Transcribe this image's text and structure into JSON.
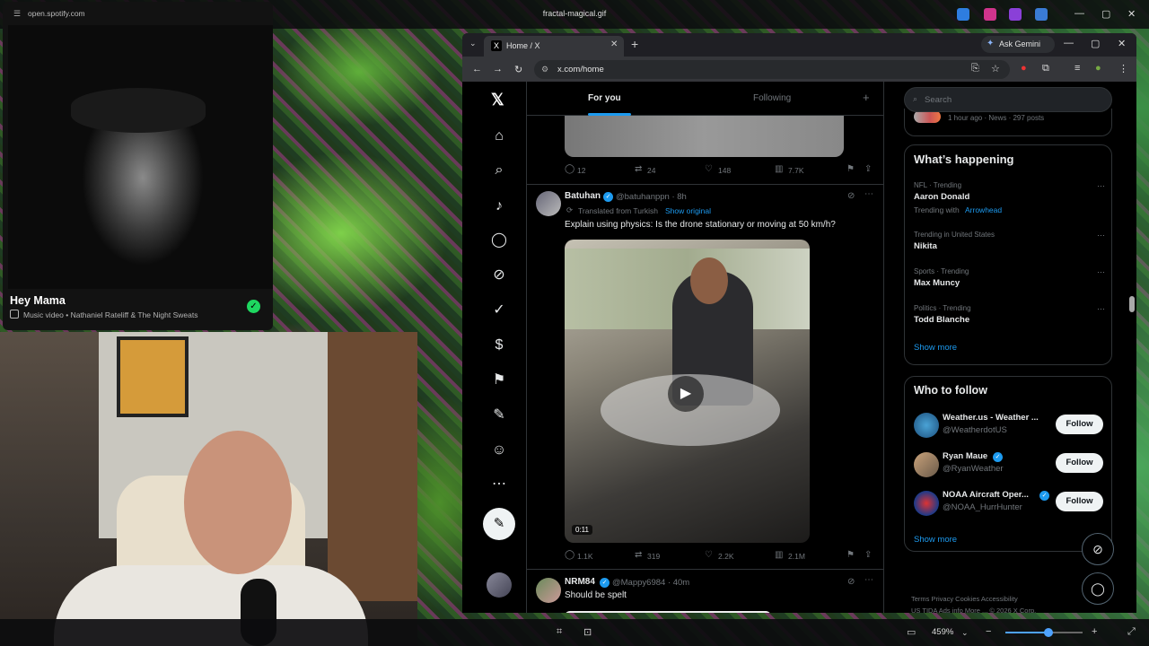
{
  "viewer": {
    "title": "fractal-magical.gif",
    "zoom": "459%",
    "zoom_level": 0.56
  },
  "spotify": {
    "url": "open.spotify.com",
    "title": "Hey Mama",
    "subtitle": "Music video • Nathaniel Rateliff & The Night Sweats"
  },
  "browser": {
    "tab_title": "Home / X",
    "url": "x.com/home",
    "gemini": "Ask Gemini"
  },
  "x": {
    "tabs": {
      "for_you": "For you",
      "following": "Following"
    },
    "prev_tweet": {
      "replies": "12",
      "reposts": "24",
      "likes": "148",
      "views": "7.7K"
    },
    "tweet": {
      "name": "Batuhan",
      "handle": "@batuhanppn · 8h",
      "translated": "Translated from Turkish",
      "show_original": "Show original",
      "text": "Explain using physics: Is the drone stationary or moving at 50 km/h?",
      "duration": "0:11",
      "replies": "1.1K",
      "reposts": "319",
      "likes": "2.2K",
      "views": "2.1M"
    },
    "tweet2": {
      "name": "NRM84",
      "handle": "@Mappy6984 · 40m",
      "text": "Should be spelt"
    },
    "search_placeholder": "Search",
    "news_meta": "1 hour ago · News · 297 posts",
    "trends": {
      "title": "What’s happening",
      "items": [
        {
          "context": "NFL · Trending",
          "name": "Aaron Donald"
        },
        {
          "context": "Trending in United States",
          "name": "Nikita"
        },
        {
          "context": "Sports · Trending",
          "name": "Max Muncy"
        },
        {
          "context": "Politics · Trending",
          "name": "Todd Blanche"
        }
      ],
      "with_prefix": "Trending with",
      "with_tag": "Arrowhead",
      "show_more": "Show more"
    },
    "who_to_follow": {
      "title": "Who to follow",
      "items": [
        {
          "name": "Weather.us - Weather ...",
          "handle": "@WeatherdotUS",
          "button": "Follow"
        },
        {
          "name": "Ryan Maue",
          "handle": "@RyanWeather",
          "button": "Follow"
        },
        {
          "name": "NOAA Aircraft Oper...",
          "handle": "@NOAA_HurrHunter",
          "button": "Follow"
        }
      ],
      "show_more": "Show more"
    },
    "footer": {
      "line1": "Terms    Privacy    Cookies    Accessibility",
      "line2": "US TIDA    Ads info    More ...    © 2026 X Corp."
    }
  }
}
